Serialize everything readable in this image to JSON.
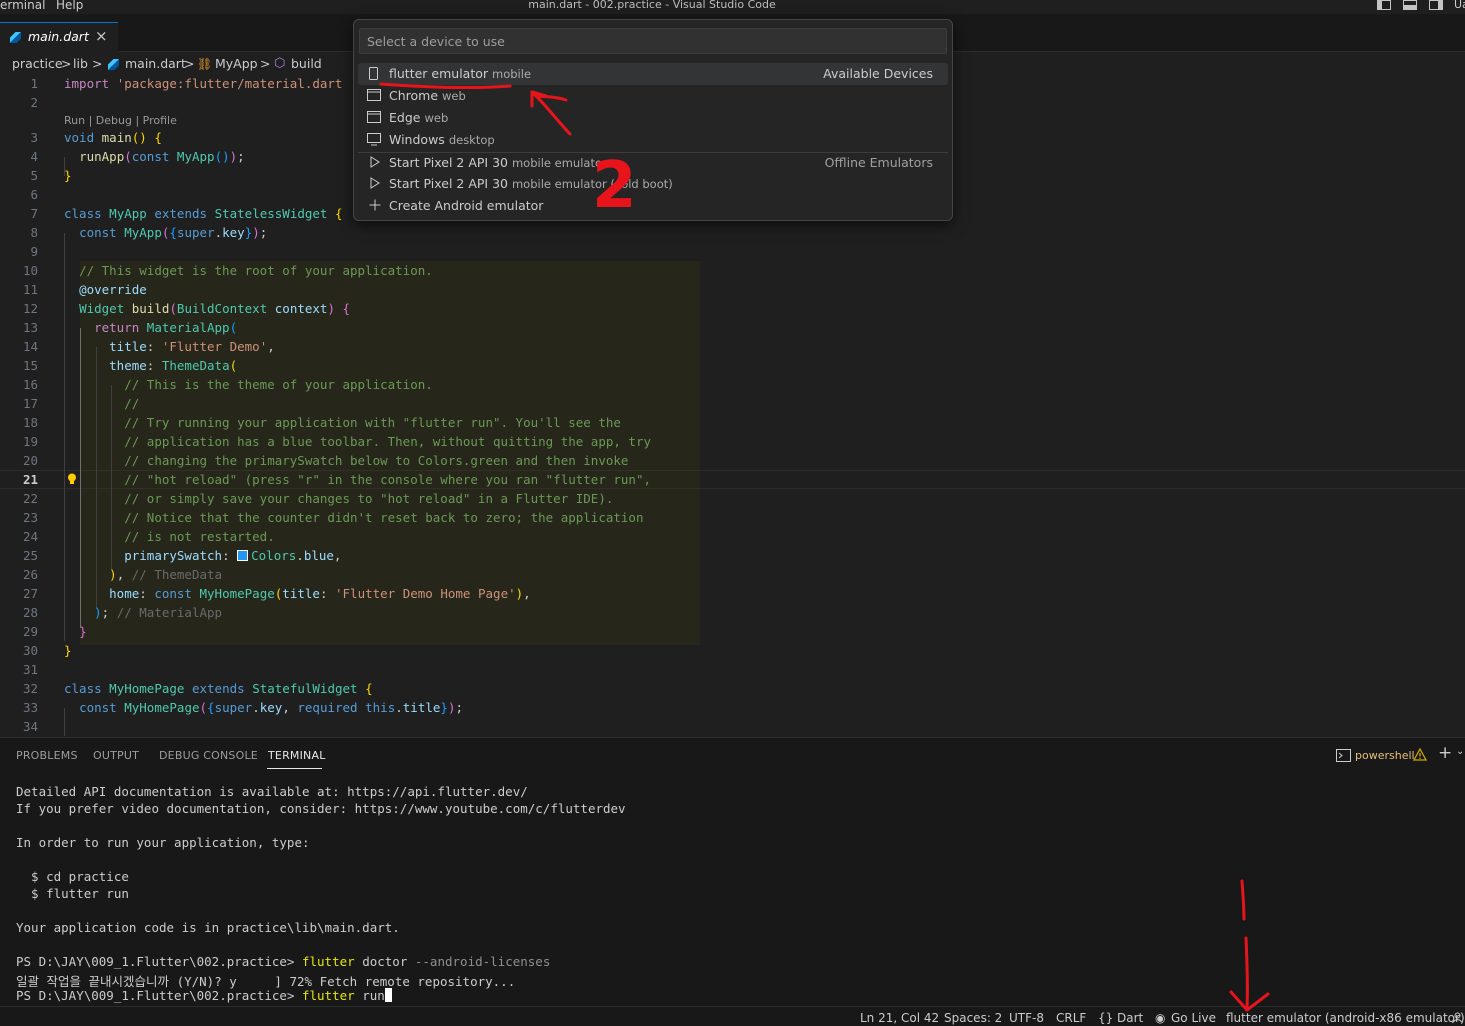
{
  "window": {
    "title": "main.dart - 002.practice - Visual Studio Code",
    "menu": [
      "erminal",
      "Help"
    ],
    "partial_right_label": "Ua"
  },
  "tabs": [
    {
      "label": "main.dart",
      "close": "×"
    }
  ],
  "breadcrumb": {
    "items": [
      "practice",
      "lib",
      "main.dart",
      "MyApp",
      "build"
    ],
    "sep": ">"
  },
  "editor": {
    "codelens": "Run | Debug | Profile",
    "line_numbers": [
      "1",
      "2",
      "3",
      "4",
      "5",
      "6",
      "7",
      "8",
      "9",
      "10",
      "11",
      "12",
      "13",
      "14",
      "15",
      "16",
      "17",
      "18",
      "19",
      "20",
      "21",
      "22",
      "23",
      "24",
      "25",
      "26",
      "27",
      "28",
      "29",
      "30",
      "31",
      "32",
      "33",
      "34"
    ],
    "current_line": "21"
  },
  "quickpick": {
    "placeholder": "Select a device to use",
    "available_group": "Available Devices",
    "offline_group": "Offline Emulators",
    "devices": [
      {
        "label": "flutter emulator",
        "desc": "mobile",
        "icon": "mobile-icon"
      },
      {
        "label": "Chrome",
        "desc": "web",
        "icon": "browser-icon"
      },
      {
        "label": "Edge",
        "desc": "web",
        "icon": "browser-icon"
      },
      {
        "label": "Windows",
        "desc": "desktop",
        "icon": "desktop-icon"
      }
    ],
    "emulators": [
      {
        "label": "Start Pixel 2 API 30",
        "desc": "mobile emulator",
        "icon": "play-icon"
      },
      {
        "label": "Start Pixel 2 API 30",
        "desc": "mobile emulator (cold boot)",
        "icon": "play-icon"
      }
    ],
    "create": {
      "label": "Create Android emulator",
      "icon": "plus-icon"
    }
  },
  "panel": {
    "tabs": [
      "PROBLEMS",
      "OUTPUT",
      "DEBUG CONSOLE",
      "TERMINAL"
    ],
    "active_tab": "TERMINAL",
    "shell": "powershell",
    "terminal": {
      "l1": "Detailed API documentation is available at: https://api.flutter.dev/",
      "l2": "If you prefer video documentation, consider: https://www.youtube.com/c/flutterdev",
      "l3": "In order to run your application, type:",
      "l4": "  $ cd practice",
      "l5": "  $ flutter run",
      "l6": "Your application code is in practice\\lib\\main.dart.",
      "prompt": "PS D:\\JAY\\009_1.Flutter\\002.practice> ",
      "cmd1": "flutter",
      "cmd1_rest": " doctor",
      "cmd1_args": " --android-licenses",
      "korean": "일괄 작업을 끝내시겠습니까 (Y/N)? y     ] 72% Fetch remote repository...",
      "cmd2": "flutter",
      "cmd2_rest": " run"
    }
  },
  "statusbar": {
    "position": "Ln 21, Col 42",
    "spaces": "Spaces: 2",
    "encoding": "UTF-8",
    "eol": "CRLF",
    "language": "Dart",
    "golive": "Go Live",
    "device": "flutter emulator (android-x86 emulator)"
  },
  "annotation": {
    "color": "#e8141c",
    "number_label": "2"
  }
}
